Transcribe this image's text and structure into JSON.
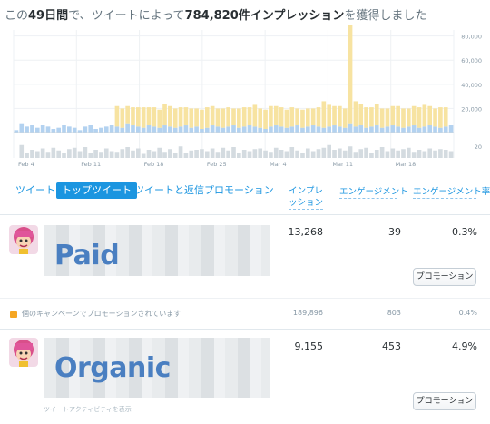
{
  "headline": {
    "prefix": "この",
    "days": "49日間",
    "middle": "で、ツイートによって",
    "impressions": "784,820件",
    "bold_suffix": "インプレッション",
    "suffix": "を獲得しました"
  },
  "chart_data": {
    "type": "bar",
    "x_tick_labels": [
      "Feb 4",
      "Feb 11",
      "Feb 18",
      "Feb 25",
      "Mar 4",
      "Mar 11",
      "Mar 18"
    ],
    "y_tick_labels": [
      "80,000",
      "60,000",
      "40,000",
      "20,000"
    ],
    "ylim": [
      0,
      85000
    ],
    "lower_y_tick_label": "20",
    "lower_ylim": [
      0,
      32
    ],
    "series": [
      {
        "color": "#f7e3a1",
        "values": [
          0,
          0,
          0,
          0,
          0,
          0,
          0,
          0,
          0,
          0,
          0,
          0,
          0,
          0,
          0,
          0,
          0,
          0,
          0,
          17000,
          16000,
          15000,
          15000,
          16000,
          17000,
          15000,
          16000,
          15000,
          18000,
          17000,
          16000,
          16000,
          15000,
          16000,
          15000,
          16000,
          17000,
          16000,
          15000,
          16000,
          16000,
          14000,
          16000,
          16000,
          15000,
          18000,
          16000,
          16000,
          17000,
          16000,
          16000,
          15000,
          16000,
          14000,
          15000,
          15000,
          14000,
          16000,
          22000,
          18000,
          16000,
          17000,
          16000,
          82000,
          21000,
          18000,
          17000,
          16000,
          18000,
          16000,
          15000,
          16000,
          17000,
          16000,
          15000,
          16000,
          17000,
          18000,
          16000,
          15000,
          17000,
          16000
        ]
      },
      {
        "color": "#b3d2f0",
        "values": [
          2000,
          7000,
          5000,
          6000,
          4000,
          6000,
          5000,
          3000,
          4000,
          6000,
          5000,
          4000,
          2000,
          5000,
          6000,
          3000,
          4000,
          5000,
          6000,
          5000,
          4000,
          7000,
          6000,
          5000,
          4000,
          6000,
          5000,
          4000,
          6000,
          5000,
          4000,
          5000,
          6000,
          4000,
          5000,
          3000,
          4000,
          6000,
          5000,
          4000,
          5000,
          6000,
          4000,
          5000,
          6000,
          5000,
          4000,
          3000,
          5000,
          6000,
          5000,
          4000,
          5000,
          6000,
          4000,
          5000,
          6000,
          5000,
          4000,
          5000,
          6000,
          5000,
          4000,
          7000,
          5000,
          6000,
          4000,
          5000,
          6000,
          4000,
          5000,
          6000,
          5000,
          4000,
          5000,
          6000,
          4000,
          5000,
          6000,
          5000,
          4000,
          5000,
          6000
        ]
      },
      {
        "color": "#d4dbe0",
        "panel": "lower",
        "values": [
          0,
          19,
          7,
          12,
          10,
          14,
          9,
          15,
          11,
          8,
          13,
          15,
          10,
          16,
          7,
          12,
          9,
          14,
          10,
          9,
          13,
          16,
          11,
          14,
          6,
          12,
          10,
          15,
          9,
          13,
          8,
          17,
          7,
          11,
          12,
          13,
          10,
          14,
          9,
          15,
          11,
          16,
          8,
          12,
          10,
          13,
          14,
          11,
          9,
          15,
          12,
          10,
          16,
          11,
          8,
          14,
          10,
          13,
          15,
          19,
          12,
          14,
          11,
          17,
          9,
          13,
          15,
          8,
          12,
          16,
          10,
          14,
          11,
          13,
          15,
          9,
          12,
          10,
          14,
          11,
          13,
          12,
          10
        ]
      }
    ]
  },
  "tabs": [
    {
      "label": "ツイート",
      "active": false
    },
    {
      "label": "トップツイート",
      "active": true
    },
    {
      "label": "ツイートと返信",
      "active": false
    },
    {
      "label": "プロモーション",
      "active": false
    }
  ],
  "columns": {
    "impressions": "インプレ\nッション",
    "engagements": "エンゲージメント",
    "engagement_rate": "エンゲージメント率"
  },
  "rows": [
    {
      "label": "Paid",
      "impressions": "13,268",
      "engagements": "39",
      "rate": "0.3%",
      "button": "プロモーション"
    },
    {
      "label": "Organic",
      "impressions": "9,155",
      "engagements": "453",
      "rate": "4.9%",
      "button": "プロモーション"
    }
  ],
  "campaign": {
    "text": "個のキャンペーンでプロモーションされています",
    "impressions": "189,896",
    "engagements": "803",
    "rate": "0.4%"
  },
  "footer_link": "ツイートアクティビティを表示",
  "colors": {
    "accent": "#1b95e0",
    "paid_impressions": "#f7e3a1",
    "organic_impressions": "#b3d2f0",
    "engagement_bars": "#d4dbe0",
    "label_blue": "#4a7fc1"
  }
}
